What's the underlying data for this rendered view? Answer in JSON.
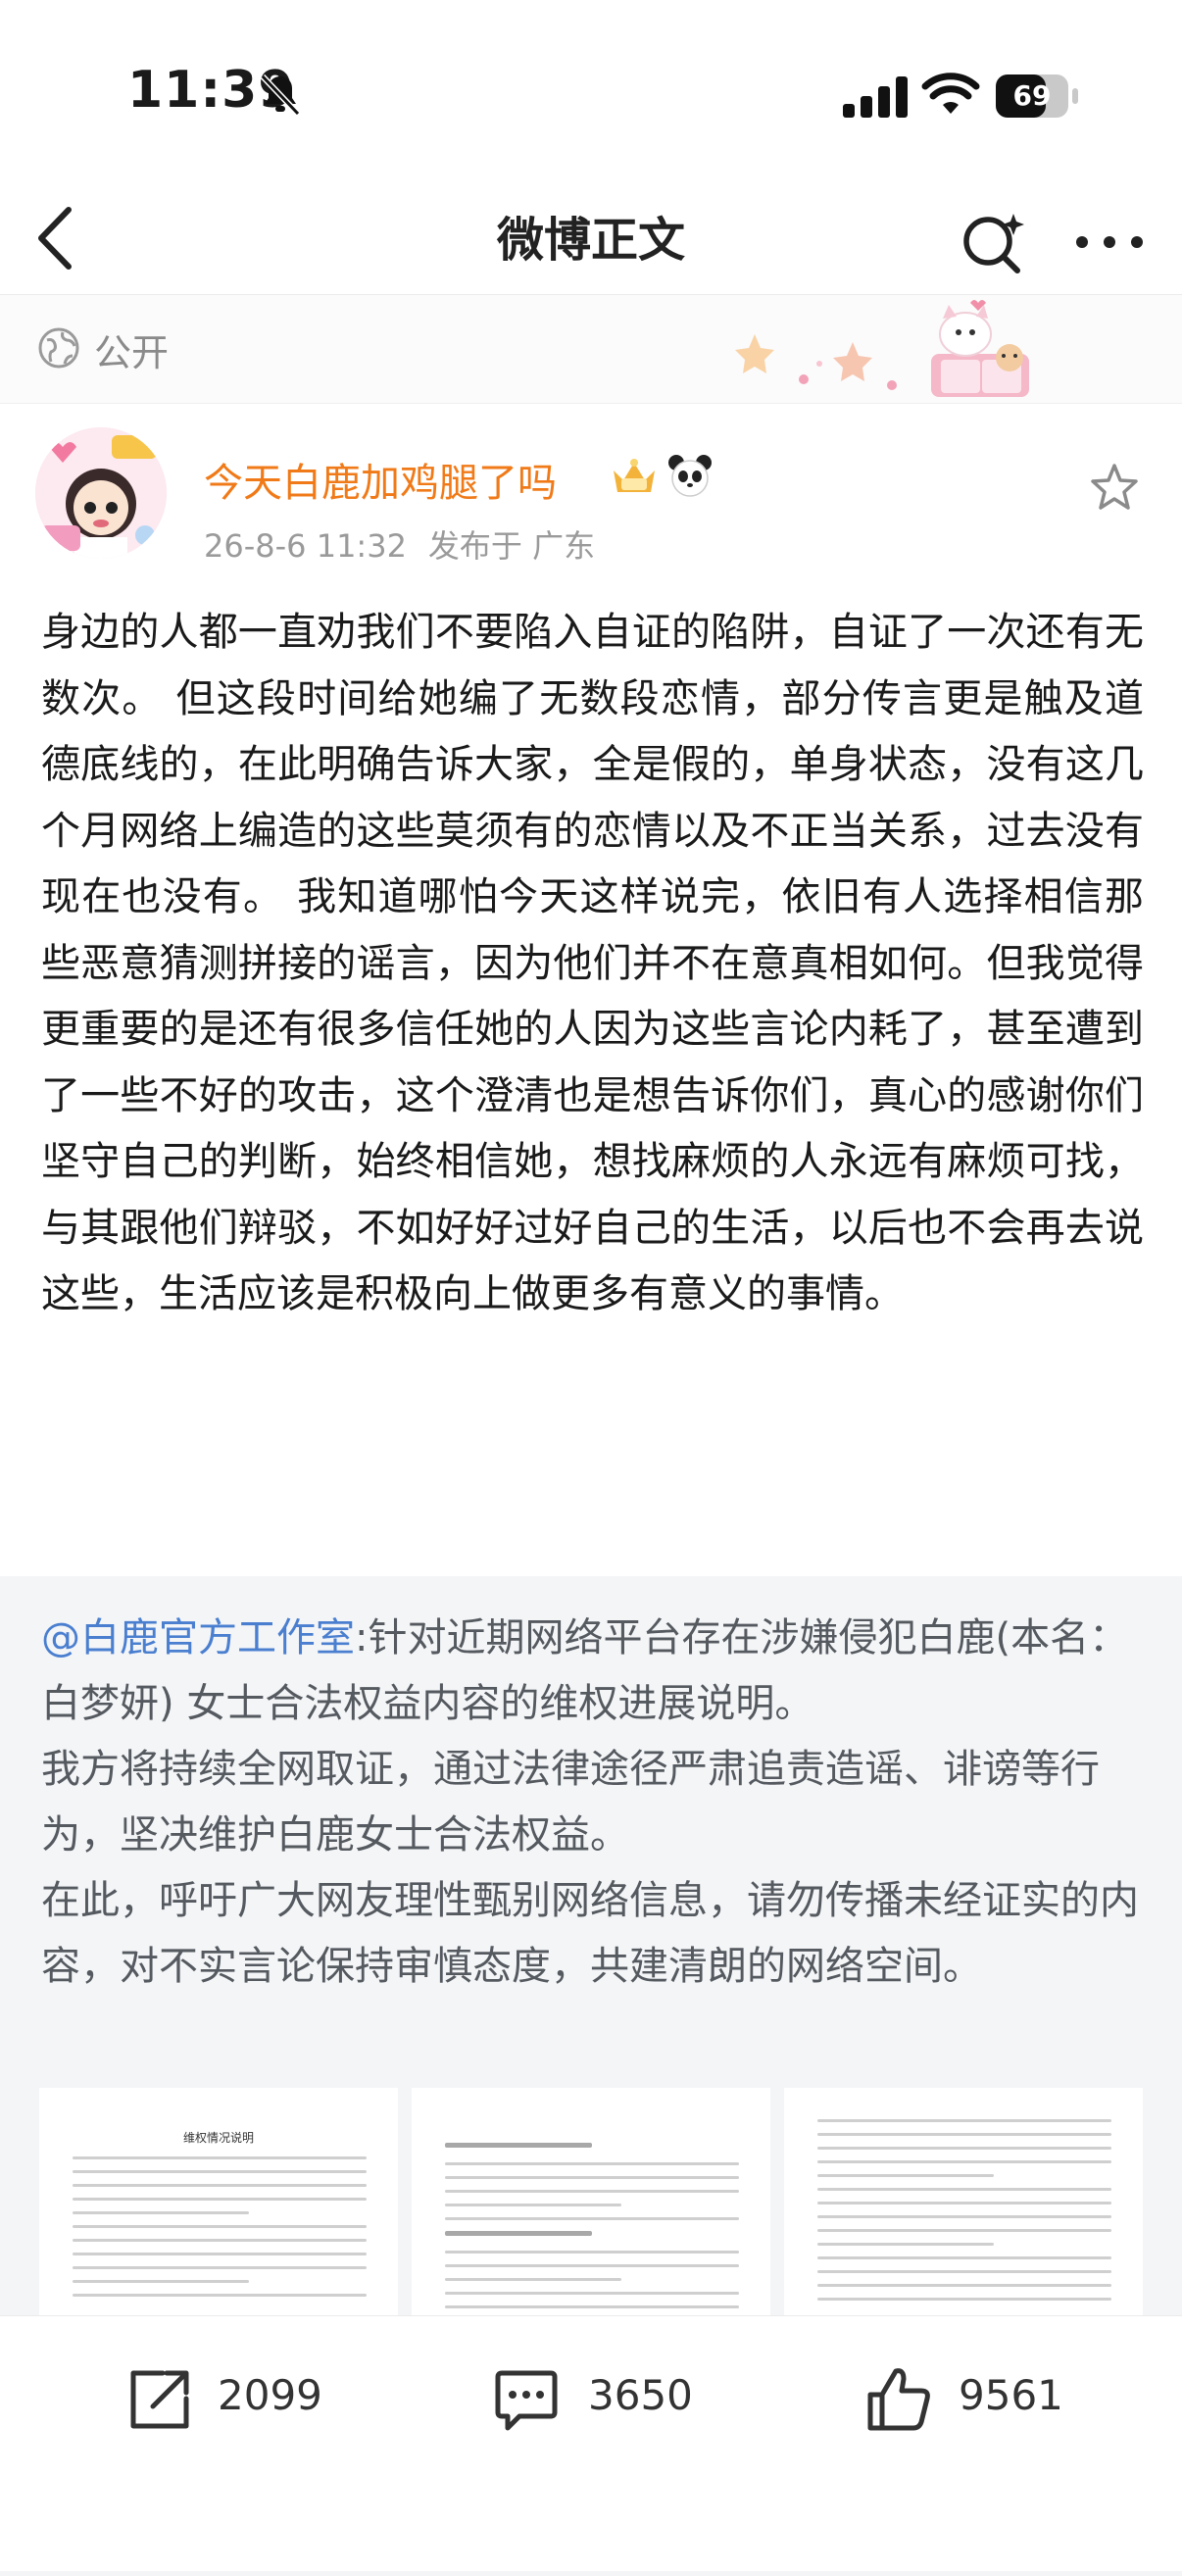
{
  "status_bar": {
    "time": "11:39",
    "battery": "69",
    "battery_level": 0.69
  },
  "nav": {
    "title": "微博正文"
  },
  "visibility": {
    "label": "公开"
  },
  "post": {
    "author": "今天白鹿加鸡腿了吗",
    "timestamp": "26-8-6 11:32",
    "location": "发布于 广东",
    "text": "身边的人都一直劝我们不要陷入自证的陷阱，自证了一次还有无数次。 但这段时间给她编了无数段恋情，部分传言更是触及道德底线的，在此明确告诉大家，全是假的，单身状态，没有这几个月网络上编造的这些莫须有的恋情以及不正当关系，过去没有现在也没有。 我知道哪怕今天这样说完，依旧有人选择相信那些恶意猜测拼接的谣言，因为他们并不在意真相如何。但我觉得更重要的是还有很多信任她的人因为这些言论内耗了，甚至遭到了一些不好的攻击，这个澄清也是想告诉你们，真心的感谢你们坚守自己的判断，始终相信她，想找麻烦的人永远有麻烦可找，与其跟他们辩驳，不如好好过好自己的生活，以后也不会再去说这些，生活应该是积极向上做更多有意义的事情。"
  },
  "repost": {
    "mention": "@白鹿官方工作室",
    "text": ":针对近期网络平台存在涉嫌侵犯白鹿(本名：白梦妍) 女士合法权益内容的维权进展说明。",
    "line2": "我方将持续全网取证，通过法律途径严肃追责造谣、诽谤等行为，坚决维护白鹿女士合法权益。",
    "line3": "在此，呼吁广大网友理性甄别网络信息，请勿传播未经证实的内容，对不实言论保持审慎态度，共建清朗的网络空间。",
    "doc_title": "维权情况说明"
  },
  "actions": {
    "share_count": "2099",
    "comment_count": "3650",
    "like_count": "9561"
  },
  "colors": {
    "author_name": "#f07a18",
    "mention": "#4a7fd0",
    "repost_bg": "#f4f5f7"
  },
  "icons": [
    "bell-muted-icon",
    "signal-icon",
    "wifi-icon",
    "battery-icon",
    "back-chevron-icon",
    "search-sparkle-icon",
    "more-dots-icon",
    "globe-icon",
    "vip-crown-icon",
    "panda-icon",
    "star-icon",
    "share-icon",
    "comment-icon",
    "like-icon"
  ]
}
